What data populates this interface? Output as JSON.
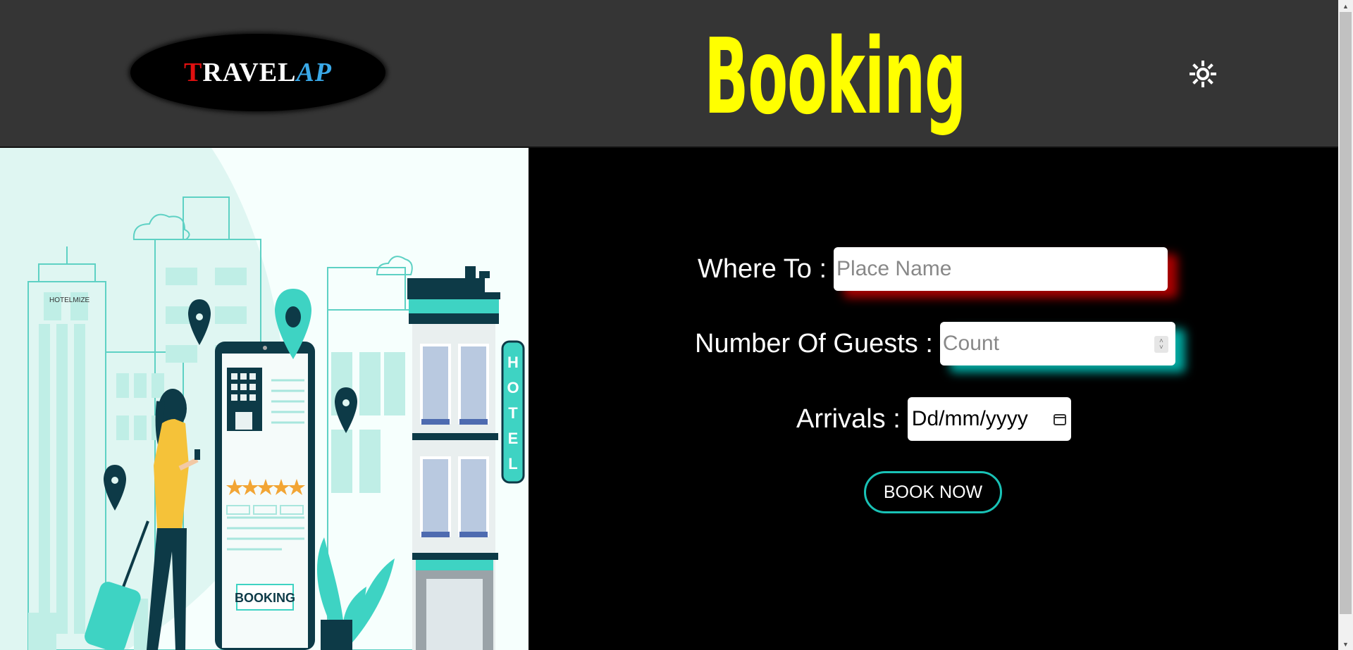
{
  "header": {
    "logo": {
      "first_letter": "T",
      "rest": "RAVEL",
      "suffix": "AP"
    },
    "title": "Booking",
    "theme_toggle_icon": "sun-icon"
  },
  "illustration": {
    "brand_sign": "HOTELMIZE",
    "hotel_sign_letters": [
      "H",
      "O",
      "T",
      "E",
      "L"
    ],
    "screen_button": "BOOKING",
    "rating_stars": 5
  },
  "form": {
    "where_to": {
      "label": "Where To :",
      "placeholder": "Place Name"
    },
    "guests": {
      "label": "Number Of Guests :",
      "placeholder": "Count"
    },
    "arrivals": {
      "label": "Arrivals :",
      "date_format": "Dd/mm/yyyy"
    },
    "submit_label": "BOOK NOW"
  },
  "colors": {
    "header_bg": "#353535",
    "title": "#ffff00",
    "accent_teal": "#19c2b6",
    "shadow_red": "#c80000",
    "illustration_teal": "#3ed3c3",
    "illustration_dark": "#0d3a47"
  }
}
